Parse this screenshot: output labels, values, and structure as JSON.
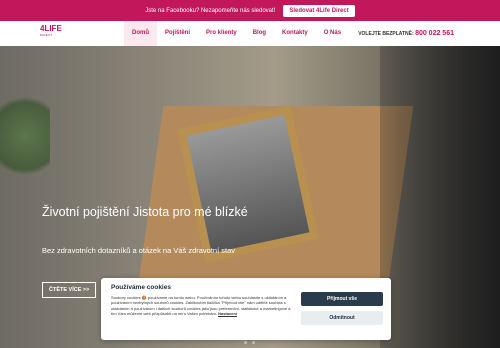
{
  "topbar": {
    "text": "Jste na Facebooku? Nezapomeňte nás sledovat!",
    "button": "Sledovat 4Life Direct"
  },
  "logo": {
    "top": "4LIFE",
    "bottom": "DIRECT"
  },
  "nav": {
    "items": [
      "Domů",
      "Pojištění",
      "Pro klienty",
      "Blog",
      "Kontakty",
      "O Nás"
    ]
  },
  "phone": {
    "label": "VOLEJTE BEZPLATNĚ:",
    "number": "800 022 561"
  },
  "hero": {
    "title": "Životní pojištění Jistota pro mé blízké",
    "subtitle": "Bez zdravotních dotazníků a otázek na Váš zdravotní stav",
    "button": "ČTĚTE VÍCE >>"
  },
  "cookie": {
    "title": "Používáme cookies",
    "text": "Soubory cookies 🍪 používáme na tomto webu. Používáním tohoto webu souhlasíte s ukládáním a používáním nezbytných souborů cookies. Zakliknutím tlačítka \"Přijmout vše\" nám udělíte souhlas s ukládáním a používáním i dalších souborů cookies jako jsou preferenční, statistické a marketingové a tím Vám můžeme web přizpůsobit na míru Vašim potřebám.",
    "link": "Nastavení",
    "accept": "Přijmout vše",
    "decline": "Odmítnout"
  }
}
